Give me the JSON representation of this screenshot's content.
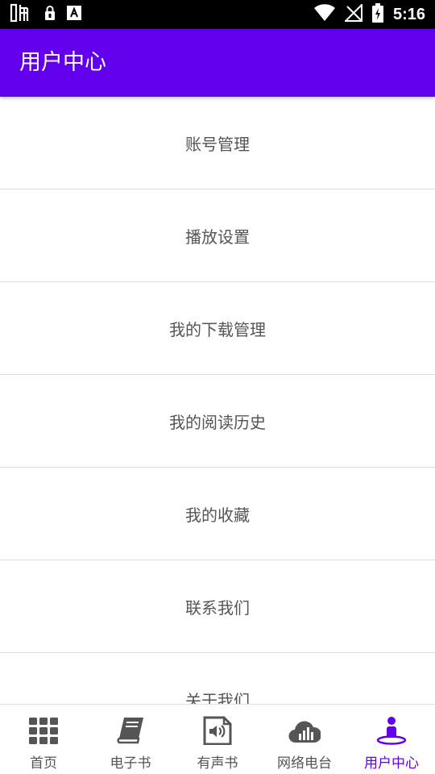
{
  "status_bar": {
    "time": "5:16",
    "left_icons": [
      "carrier-logo-icon",
      "lock-icon",
      "keyboard-a-icon"
    ],
    "right_icons": [
      "wifi-icon",
      "no-signal-icon",
      "battery-charging-icon"
    ]
  },
  "app_bar": {
    "title": "用户中心",
    "color": "#6200EE"
  },
  "menu": {
    "items": [
      {
        "label": "账号管理"
      },
      {
        "label": "播放设置"
      },
      {
        "label": "我的下载管理"
      },
      {
        "label": "我的阅读历史"
      },
      {
        "label": "我的收藏"
      },
      {
        "label": "联系我们"
      },
      {
        "label": "关于我们"
      }
    ]
  },
  "tabs": [
    {
      "label": "首页",
      "icon": "grid-icon",
      "active": false
    },
    {
      "label": "电子书",
      "icon": "book-icon",
      "active": false
    },
    {
      "label": "有声书",
      "icon": "audio-book-icon",
      "active": false
    },
    {
      "label": "网络电台",
      "icon": "cloud-radio-icon",
      "active": false
    },
    {
      "label": "用户中心",
      "icon": "user-icon",
      "active": true
    }
  ],
  "colors": {
    "accent": "#6200EE",
    "inactive": "#555555"
  }
}
